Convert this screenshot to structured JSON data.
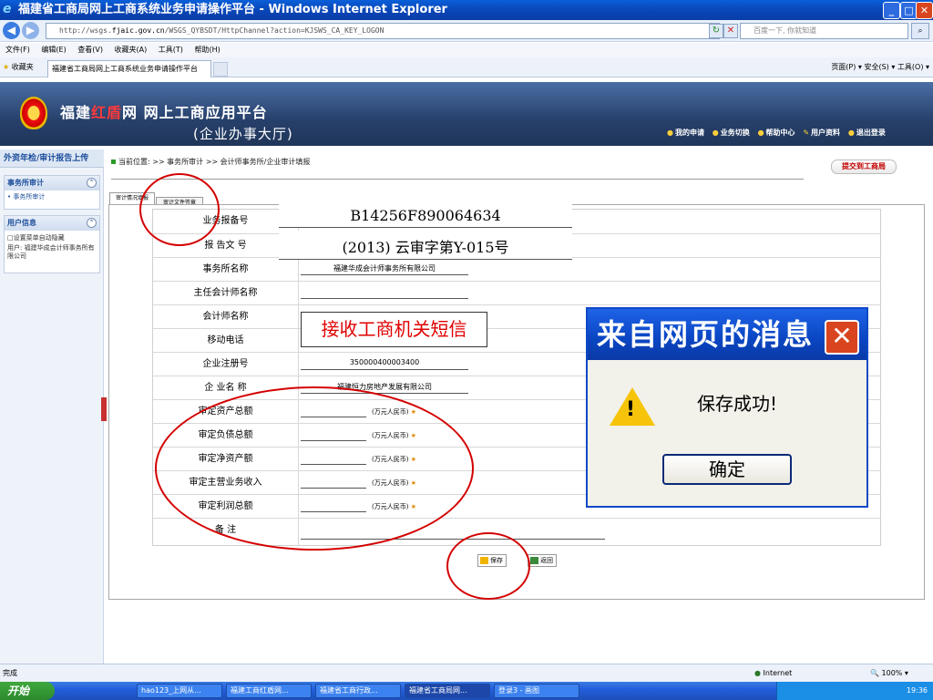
{
  "window": {
    "title": "福建省工商局网上工商系统业务申请操作平台 - Windows Internet Explorer"
  },
  "address_bar": {
    "url_prefix": "http://wsgs.",
    "url_domain": "fjaic.gov.cn",
    "url_path": "/WSGS_QYBSDT/HttpChannel?action=KJSWS_CA_KEY_LOGON",
    "search_placeholder": "百度一下, 你就知道"
  },
  "menu": [
    "文件(F)",
    "编辑(E)",
    "查看(V)",
    "收藏夹(A)",
    "工具(T)",
    "帮助(H)"
  ],
  "favbar": {
    "favorites_label": "收藏夹",
    "tab_title": "福建省工商局网上工商系统业务申请操作平台",
    "commands": "页面(P) ▾  安全(S) ▾  工具(O) ▾"
  },
  "header": {
    "brand_prefix": "福建",
    "brand_red": "红盾",
    "brand_suffix": "网  网上工商应用平台",
    "hall": "(企业办事大厅)",
    "links": [
      "我的申请",
      "业务切换",
      "帮助中心",
      "用户资料",
      "退出登录"
    ]
  },
  "sidebar": {
    "title": "外资年检/审计报告上传",
    "panel1_title": "事务所审计",
    "panel1_item": "• 事务所审计",
    "panel2_title": "用户信息",
    "auto_hide": "□设置菜单自动隐藏",
    "user": "用户: 福建华成会计师事务所有限公司"
  },
  "breadcrumb": "当前位置: >> 事务所审计 >> 会计师事务所/企业审计填报",
  "submit_button": "提交到工商局",
  "tabs": [
    "审计情况填报",
    "审计文件签章"
  ],
  "form": {
    "rows": [
      {
        "label": "业务报备号",
        "value": ""
      },
      {
        "label": "报 告文 号",
        "value": ""
      },
      {
        "label": "事务所名称",
        "value": "福建华成会计师事务所有限公司"
      },
      {
        "label": "主任会计师名称",
        "value": ""
      },
      {
        "label": "会计师名称",
        "value": ""
      },
      {
        "label": "移动电话",
        "value": ""
      },
      {
        "label": "企业注册号",
        "value": "350000400003400"
      },
      {
        "label": "企 业名 称",
        "value": "福建恒力房地产发展有限公司"
      },
      {
        "label": "审定资产总额",
        "unit": "(万元人民币)"
      },
      {
        "label": "审定负债总额",
        "unit": "(万元人民币)"
      },
      {
        "label": "审定净资产额",
        "unit": "(万元人民币)"
      },
      {
        "label": "审定主营业务收入",
        "unit": "(万元人民币)"
      },
      {
        "label": "审定利润总额",
        "unit": "(万元人民币)"
      },
      {
        "label": "备 注",
        "value": ""
      }
    ],
    "report_filing_no": "B14256F890064634",
    "report_doc_no": "(2013) 云审字第Y-015号",
    "sms_notice": "接收工商机关短信",
    "star": "★"
  },
  "buttons": {
    "save": "保存",
    "back": "返回"
  },
  "dialog": {
    "title": "来自网页的消息",
    "message": "保存成功!",
    "ok": "确定"
  },
  "statusbar": {
    "left": "完成",
    "zone": "Internet",
    "zoom": "100%"
  },
  "taskbar": {
    "start": "开始",
    "tasks": [
      "hao123_上网从...",
      "福建工商红盾网...",
      "福建省工商行政...",
      "福建省工商局网...",
      "登录3 - 画图"
    ],
    "time": "19:36"
  },
  "colors": {
    "title_blue": "#0a4fc9",
    "header_navy": "#27406b",
    "annotation_red": "#d40000",
    "notice_red": "#e00000"
  }
}
